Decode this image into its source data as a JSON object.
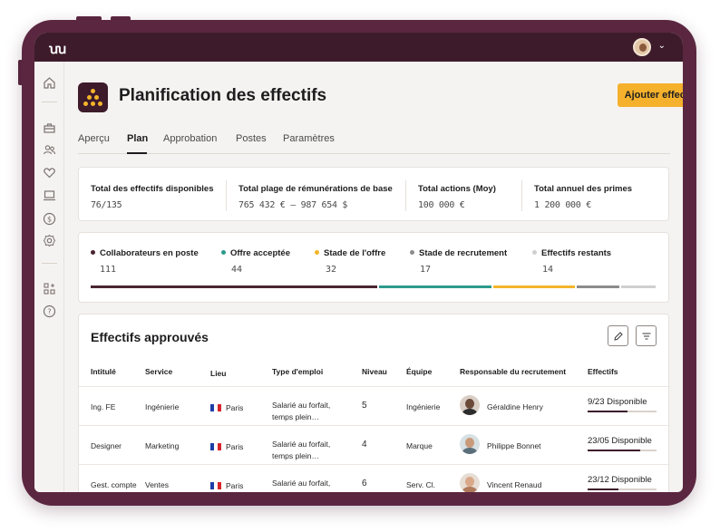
{
  "app": {
    "logo": "ꭒꭒ"
  },
  "header": {
    "title": "Planification des effectifs",
    "add_button": "Ajouter effectifs"
  },
  "tabs": [
    "Aperçu",
    "Plan",
    "Approbation",
    "Postes",
    "Paramètres"
  ],
  "active_tab": "Plan",
  "kpis": [
    {
      "label": "Total des effectifs disponibles",
      "value": "76/135"
    },
    {
      "label": "Total plage de rémunérations de base",
      "value": "765 432 € – 987 654 $"
    },
    {
      "label": "Total actions (Moy)",
      "value": "100 000 €"
    },
    {
      "label": "Total annuel des primes",
      "value": "1 200 000 €"
    }
  ],
  "pipeline": [
    {
      "label": "Collaborateurs en poste",
      "value": "111",
      "color": "#4a2433"
    },
    {
      "label": "Offre acceptée",
      "value": "44",
      "color": "#2c9a8c"
    },
    {
      "label": "Stade de l'offre",
      "value": "32",
      "color": "#f4b52a"
    },
    {
      "label": "Stade de recrutement",
      "value": "17",
      "color": "#8c8c8c"
    },
    {
      "label": "Effectifs restants",
      "value": "14",
      "color": "#cfcfcf"
    }
  ],
  "table": {
    "title": "Effectifs approuvés",
    "columns": [
      "Intitulé",
      "Service",
      "Lieu",
      "Type d'emploi",
      "Niveau",
      "Équipe",
      "Responsable du recrutement",
      "Effectifs"
    ],
    "rows": [
      {
        "title": "Ing. FE",
        "service": "Ingénierie",
        "location": "Paris",
        "employment_line1": "Salarié au forfait,",
        "employment_line2": "temps plein…",
        "level": "5",
        "team": "Ingénierie",
        "recruiter": "Géraldine Henry",
        "headcount": "9/23 Disponible",
        "fill": 0.58
      },
      {
        "title": "Designer",
        "service": "Marketing",
        "location": "Paris",
        "employment_line1": "Salarié au forfait,",
        "employment_line2": "temps plein…",
        "level": "4",
        "team": "Marque",
        "recruiter": "Philippe Bonnet",
        "headcount": "23/05 Disponible",
        "fill": 0.76
      },
      {
        "title": "Gest. compte",
        "service": "Ventes",
        "location": "Paris",
        "employment_line1": "Salarié au forfait,",
        "employment_line2": "",
        "level": "6",
        "team": "Serv. Cl.",
        "recruiter": "Vincent Renaud",
        "headcount": "23/12 Disponible",
        "fill": 0.45
      }
    ]
  },
  "icons": {
    "sidebar": [
      "home-icon",
      "briefcase-icon",
      "people-icon",
      "heart-icon",
      "laptop-icon",
      "dollar-icon",
      "settings-icon",
      "apps-icon",
      "help-icon"
    ],
    "table_actions": [
      "pencil-icon",
      "filter-icon"
    ]
  }
}
